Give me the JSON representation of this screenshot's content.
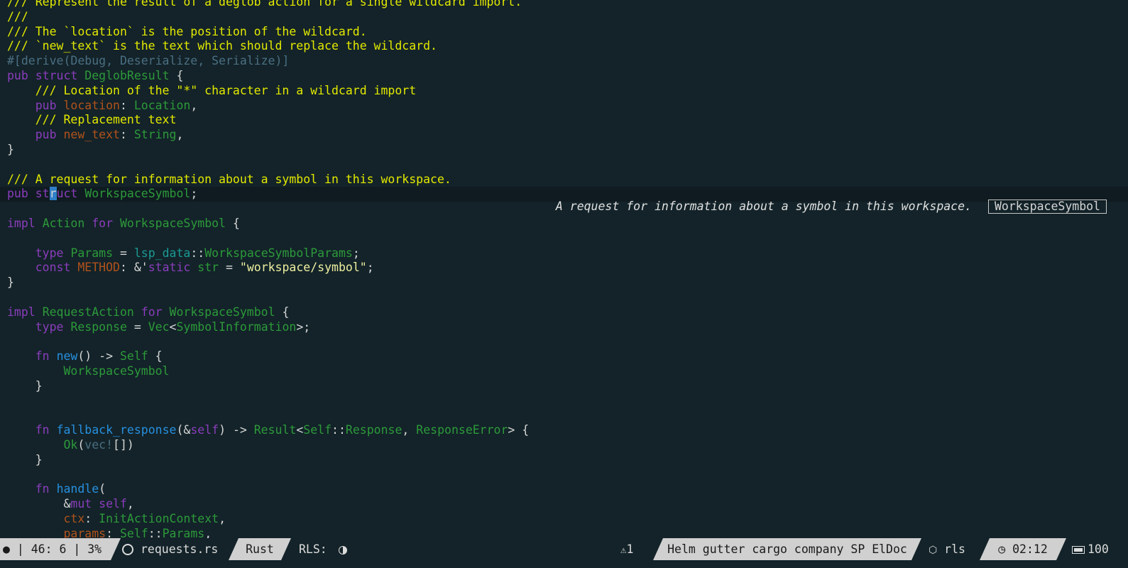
{
  "editor": {
    "lines": [
      [
        {
          "t": "/// Represent the result of a deglob action for a single wildcard import.",
          "c": "doc"
        }
      ],
      [
        {
          "t": "///",
          "c": "doc"
        }
      ],
      [
        {
          "t": "/// The `location` is the position of the wildcard.",
          "c": "doc"
        }
      ],
      [
        {
          "t": "/// `new_text` is the text which should replace the wildcard.",
          "c": "doc"
        }
      ],
      [
        {
          "t": "#[derive(Debug, Deserialize, Serialize)]",
          "c": "attr"
        }
      ],
      [
        {
          "t": "pub",
          "c": "kw"
        },
        {
          "t": " ",
          "c": "plain"
        },
        {
          "t": "struct",
          "c": "kw"
        },
        {
          "t": " ",
          "c": "plain"
        },
        {
          "t": "DeglobResult",
          "c": "type"
        },
        {
          "t": " {",
          "c": "plain"
        }
      ],
      [
        {
          "t": "    /// Location of the \"*\" character in a wildcard import",
          "c": "doc"
        }
      ],
      [
        {
          "t": "    ",
          "c": "plain"
        },
        {
          "t": "pub",
          "c": "kw"
        },
        {
          "t": " ",
          "c": "plain"
        },
        {
          "t": "location",
          "c": "field"
        },
        {
          "t": ": ",
          "c": "plain"
        },
        {
          "t": "Location",
          "c": "type"
        },
        {
          "t": ",",
          "c": "plain"
        }
      ],
      [
        {
          "t": "    /// Replacement text",
          "c": "doc"
        }
      ],
      [
        {
          "t": "    ",
          "c": "plain"
        },
        {
          "t": "pub",
          "c": "kw"
        },
        {
          "t": " ",
          "c": "plain"
        },
        {
          "t": "new_text",
          "c": "field"
        },
        {
          "t": ": ",
          "c": "plain"
        },
        {
          "t": "String",
          "c": "type"
        },
        {
          "t": ",",
          "c": "plain"
        }
      ],
      [
        {
          "t": "}",
          "c": "plain"
        }
      ],
      [],
      [
        {
          "t": "/// A request for information about a symbol in this workspace.",
          "c": "doc"
        }
      ],
      [
        {
          "t": "pub",
          "c": "kw"
        },
        {
          "t": " ",
          "c": "plain"
        },
        {
          "t": "st",
          "c": "kw"
        },
        {
          "t": "r",
          "c": "cursor"
        },
        {
          "t": "uct",
          "c": "kw"
        },
        {
          "t": " ",
          "c": "plain"
        },
        {
          "t": "WorkspaceSymbol",
          "c": "type"
        },
        {
          "t": ";",
          "c": "plain"
        }
      ],
      [],
      [
        {
          "t": "impl",
          "c": "kw"
        },
        {
          "t": " ",
          "c": "plain"
        },
        {
          "t": "Action",
          "c": "type"
        },
        {
          "t": " ",
          "c": "plain"
        },
        {
          "t": "for",
          "c": "kw"
        },
        {
          "t": " ",
          "c": "plain"
        },
        {
          "t": "WorkspaceSymbol",
          "c": "type"
        },
        {
          "t": " {",
          "c": "plain"
        }
      ],
      [],
      [
        {
          "t": "    ",
          "c": "plain"
        },
        {
          "t": "type",
          "c": "kw"
        },
        {
          "t": " ",
          "c": "plain"
        },
        {
          "t": "Params",
          "c": "type"
        },
        {
          "t": " = ",
          "c": "plain"
        },
        {
          "t": "lsp_data",
          "c": "mod"
        },
        {
          "t": "::",
          "c": "plain"
        },
        {
          "t": "WorkspaceSymbolParams",
          "c": "type"
        },
        {
          "t": ";",
          "c": "plain"
        }
      ],
      [
        {
          "t": "    ",
          "c": "plain"
        },
        {
          "t": "const",
          "c": "kw"
        },
        {
          "t": " ",
          "c": "plain"
        },
        {
          "t": "METHOD",
          "c": "field"
        },
        {
          "t": ": &'",
          "c": "plain"
        },
        {
          "t": "static",
          "c": "kw"
        },
        {
          "t": " ",
          "c": "plain"
        },
        {
          "t": "str",
          "c": "type"
        },
        {
          "t": " = ",
          "c": "plain"
        },
        {
          "t": "\"workspace/symbol\"",
          "c": "str"
        },
        {
          "t": ";",
          "c": "plain"
        }
      ],
      [
        {
          "t": "}",
          "c": "plain"
        }
      ],
      [],
      [
        {
          "t": "impl",
          "c": "kw"
        },
        {
          "t": " ",
          "c": "plain"
        },
        {
          "t": "RequestAction",
          "c": "type"
        },
        {
          "t": " ",
          "c": "plain"
        },
        {
          "t": "for",
          "c": "kw"
        },
        {
          "t": " ",
          "c": "plain"
        },
        {
          "t": "WorkspaceSymbol",
          "c": "type"
        },
        {
          "t": " {",
          "c": "plain"
        }
      ],
      [
        {
          "t": "    ",
          "c": "plain"
        },
        {
          "t": "type",
          "c": "kw"
        },
        {
          "t": " ",
          "c": "plain"
        },
        {
          "t": "Response",
          "c": "type"
        },
        {
          "t": " = ",
          "c": "plain"
        },
        {
          "t": "Vec",
          "c": "type"
        },
        {
          "t": "<",
          "c": "plain"
        },
        {
          "t": "SymbolInformation",
          "c": "type"
        },
        {
          "t": ">;",
          "c": "plain"
        }
      ],
      [],
      [
        {
          "t": "    ",
          "c": "plain"
        },
        {
          "t": "fn",
          "c": "kw"
        },
        {
          "t": " ",
          "c": "plain"
        },
        {
          "t": "new",
          "c": "fn"
        },
        {
          "t": "() -> ",
          "c": "plain"
        },
        {
          "t": "Self",
          "c": "type"
        },
        {
          "t": " {",
          "c": "plain"
        }
      ],
      [
        {
          "t": "        ",
          "c": "plain"
        },
        {
          "t": "WorkspaceSymbol",
          "c": "type"
        }
      ],
      [
        {
          "t": "    }",
          "c": "plain"
        }
      ],
      [],
      [],
      [
        {
          "t": "    ",
          "c": "plain"
        },
        {
          "t": "fn",
          "c": "kw"
        },
        {
          "t": " ",
          "c": "plain"
        },
        {
          "t": "fallback_response",
          "c": "fn"
        },
        {
          "t": "(&",
          "c": "plain"
        },
        {
          "t": "self",
          "c": "kw"
        },
        {
          "t": ") -> ",
          "c": "plain"
        },
        {
          "t": "Result",
          "c": "type"
        },
        {
          "t": "<",
          "c": "plain"
        },
        {
          "t": "Self",
          "c": "type"
        },
        {
          "t": "::",
          "c": "plain"
        },
        {
          "t": "Response",
          "c": "type"
        },
        {
          "t": ", ",
          "c": "plain"
        },
        {
          "t": "ResponseError",
          "c": "type"
        },
        {
          "t": "> {",
          "c": "plain"
        }
      ],
      [
        {
          "t": "        ",
          "c": "plain"
        },
        {
          "t": "Ok",
          "c": "type"
        },
        {
          "t": "(",
          "c": "plain"
        },
        {
          "t": "vec!",
          "c": "macro"
        },
        {
          "t": "[])",
          "c": "plain"
        }
      ],
      [
        {
          "t": "    }",
          "c": "plain"
        }
      ],
      [],
      [
        {
          "t": "    ",
          "c": "plain"
        },
        {
          "t": "fn",
          "c": "kw"
        },
        {
          "t": " ",
          "c": "plain"
        },
        {
          "t": "handle",
          "c": "fn"
        },
        {
          "t": "(",
          "c": "plain"
        }
      ],
      [
        {
          "t": "        &",
          "c": "plain"
        },
        {
          "t": "mut",
          "c": "kw"
        },
        {
          "t": " ",
          "c": "plain"
        },
        {
          "t": "self",
          "c": "kw"
        },
        {
          "t": ",",
          "c": "plain"
        }
      ],
      [
        {
          "t": "        ",
          "c": "plain"
        },
        {
          "t": "ctx",
          "c": "field"
        },
        {
          "t": ": ",
          "c": "plain"
        },
        {
          "t": "InitActionContext",
          "c": "type"
        },
        {
          "t": ",",
          "c": "plain"
        }
      ],
      [
        {
          "t": "        ",
          "c": "plain"
        },
        {
          "t": "params",
          "c": "field"
        },
        {
          "t": ": ",
          "c": "plain"
        },
        {
          "t": "Self",
          "c": "type"
        },
        {
          "t": "::",
          "c": "plain"
        },
        {
          "t": "Params",
          "c": "type"
        },
        {
          "t": ",",
          "c": "plain"
        }
      ]
    ],
    "current_line": 13
  },
  "eldoc": {
    "doc": "A request for information about a symbol in this workspace.",
    "symbol": "WorkspaceSymbol"
  },
  "modeline": {
    "position": "● | 46: 6 | 3%",
    "file_icon": "rust-icon",
    "filename": "requests.rs",
    "major_mode": "Rust",
    "rls_status": "RLS:",
    "warnings": "1",
    "minor_modes": "Helm gutter cargo company SP ElDoc",
    "project": "rls",
    "time": "02:12",
    "battery": "100"
  },
  "colors": {
    "background": "#132329",
    "doc": "#e3e900",
    "keyword": "#8b3dbd",
    "type": "#2d9a3a",
    "field": "#b1521c",
    "function": "#2790e0",
    "cursor": "#2f7ec7",
    "modeline_segment": "#d0d0d0"
  }
}
